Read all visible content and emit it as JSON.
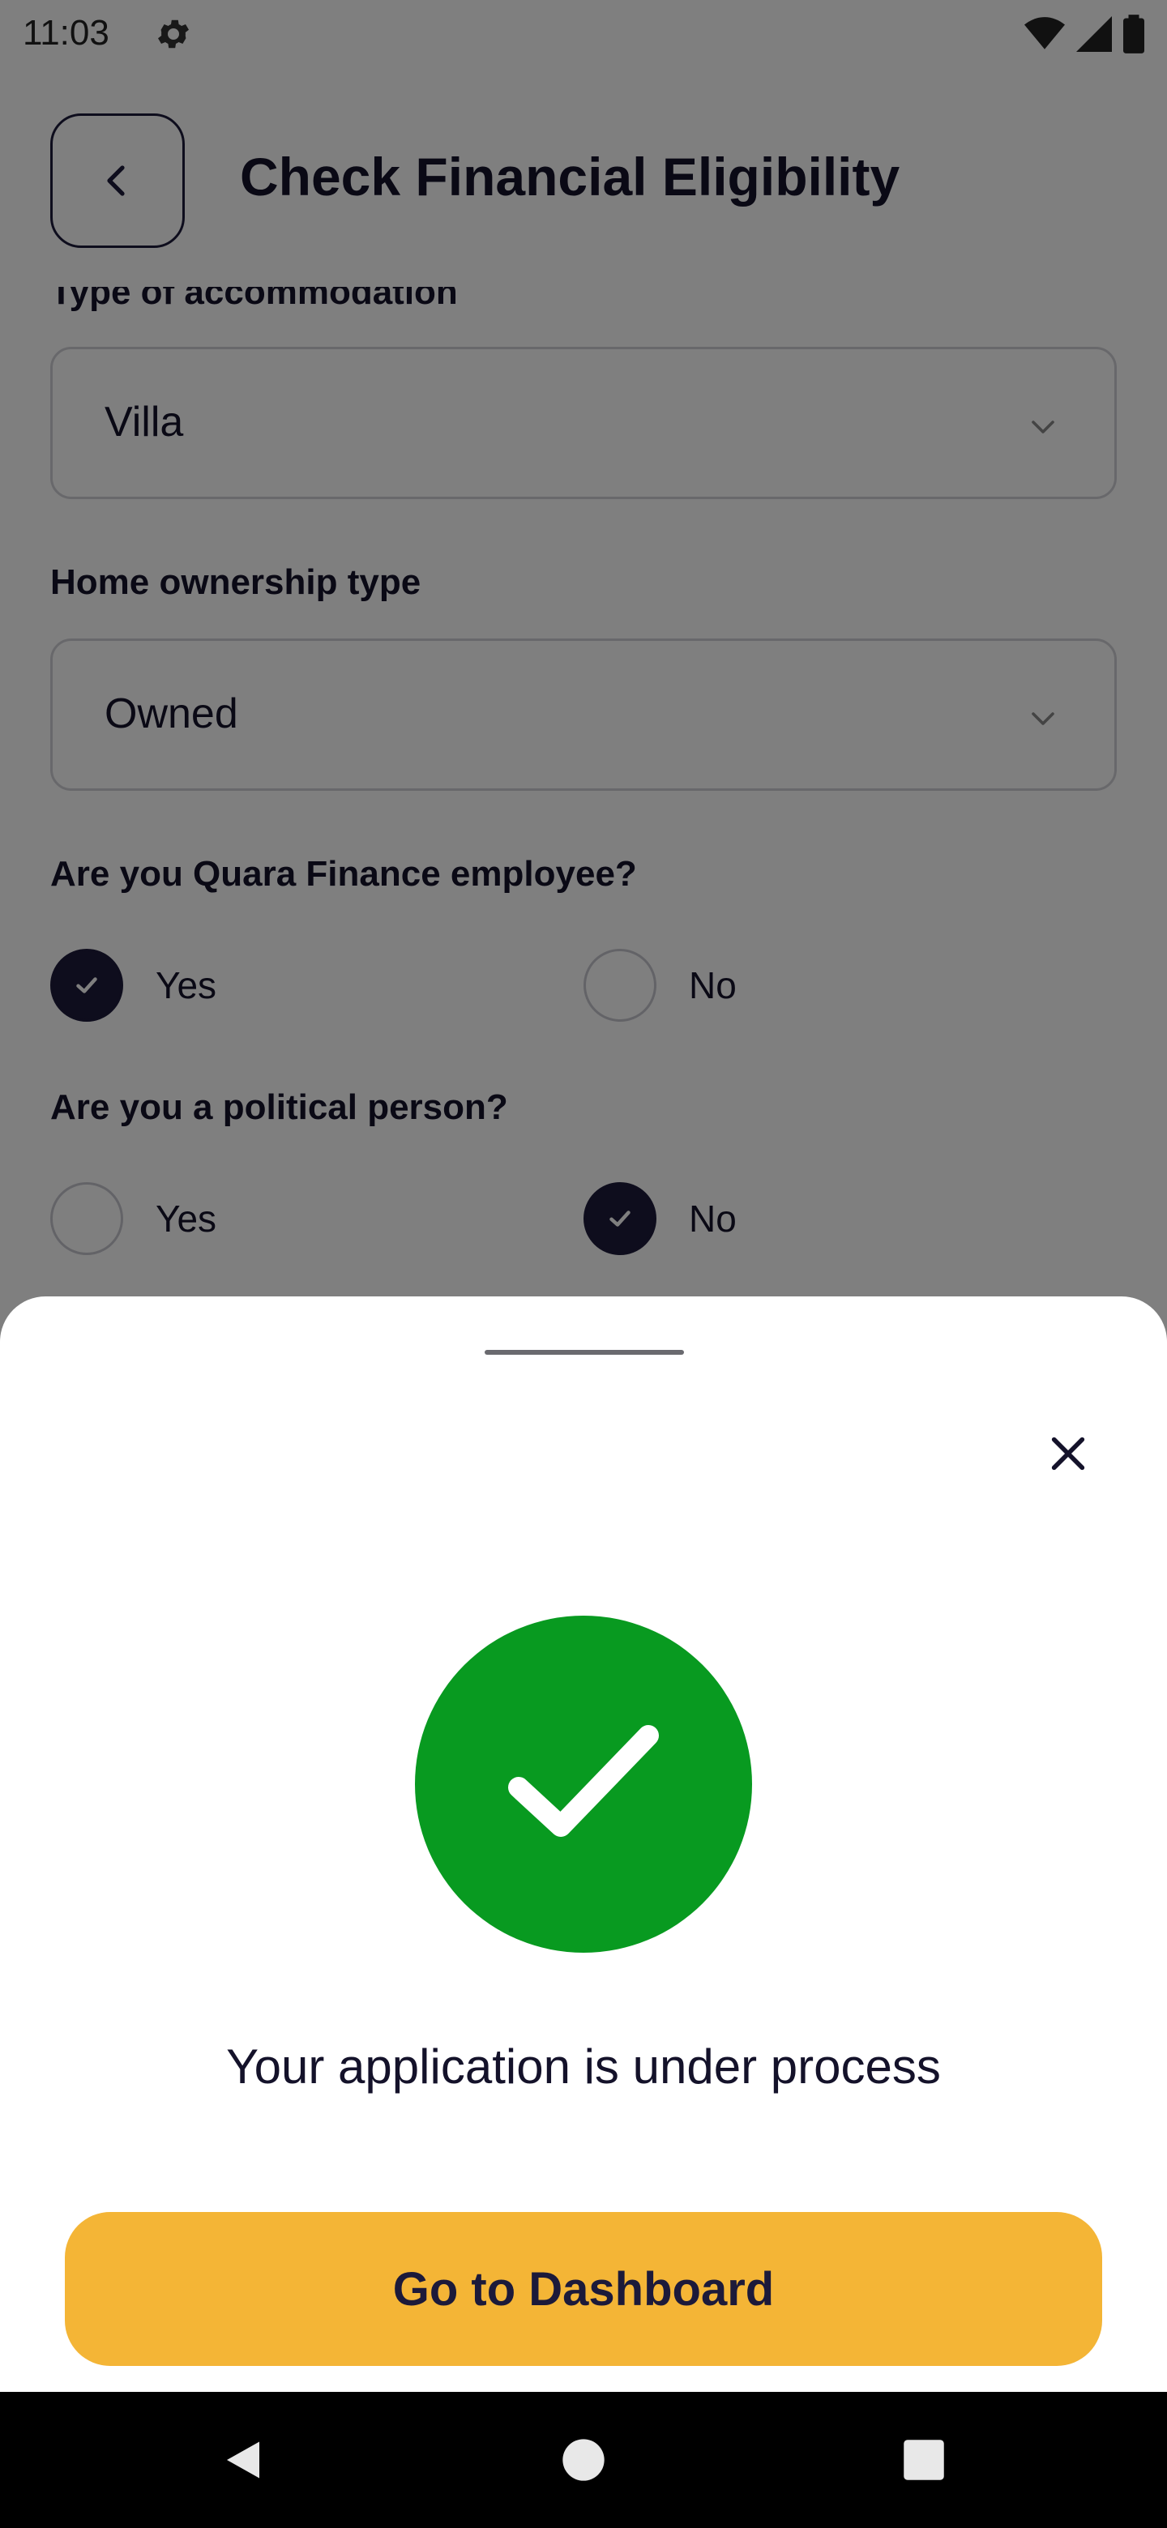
{
  "status_bar": {
    "time": "11:03",
    "icons": [
      "gear-icon",
      "wifi-icon",
      "signal-icon",
      "battery-icon"
    ]
  },
  "header": {
    "title": "Check Financial Eligibility",
    "back_icon": "chevron-left-icon"
  },
  "form": {
    "accommodation": {
      "label": "Type of accommodation",
      "value": "Villa"
    },
    "ownership": {
      "label": "Home ownership type",
      "value": "Owned"
    },
    "employee": {
      "label": "Are you Quara Finance employee?",
      "options": [
        "Yes",
        "No"
      ],
      "selected": "Yes"
    },
    "political": {
      "label": "Are you a political person?",
      "options": [
        "Yes",
        "No"
      ],
      "selected": "No"
    }
  },
  "sheet": {
    "message": "Your application is under process",
    "button_label": "Go to Dashboard",
    "close_icon": "close-icon",
    "status_icon": "checkmark-icon"
  },
  "colors": {
    "primary_dark": "#1c1a3a",
    "success_green": "#089a20",
    "button_yellow": "#f4b536",
    "scrim": "rgba(0,0,0,0.5)"
  }
}
